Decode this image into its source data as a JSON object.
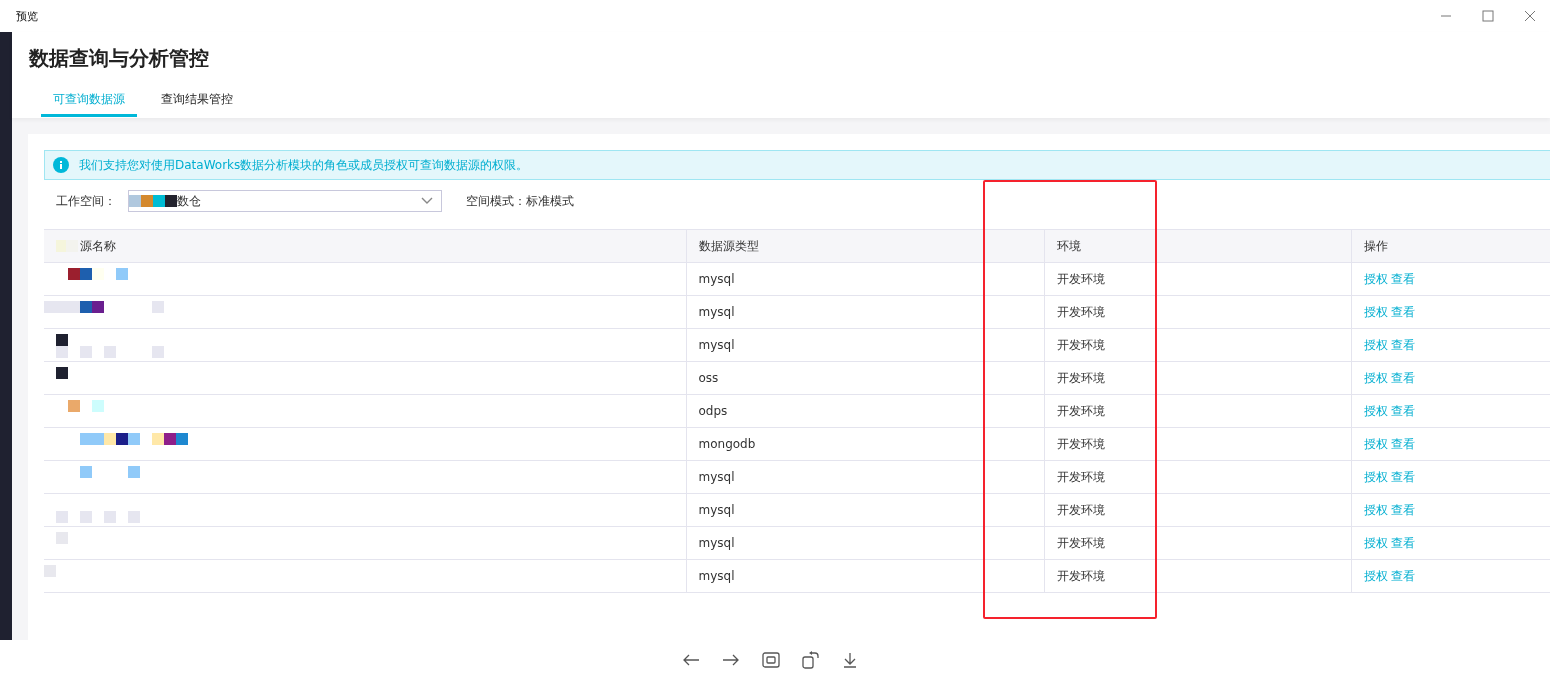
{
  "window": {
    "title": "预览"
  },
  "page": {
    "title": "数据查询与分析管控"
  },
  "tabs": [
    {
      "label": "可查询数据源",
      "selected": true
    },
    {
      "label": "查询结果管控",
      "selected": false
    }
  ],
  "notice": "我们支持您对使用DataWorks数据分析模块的角色或成员授权可查询数据源的权限。",
  "filters": {
    "workspace_label": "工作空间：",
    "workspace_value": "数仓",
    "mode": "空间模式：标准模式"
  },
  "table": {
    "columns": [
      "源名称",
      "数据源类型",
      "环境",
      "操作"
    ],
    "rows": [
      {
        "type": "mysql",
        "env": "开发环境",
        "actions": [
          "授权",
          "查看"
        ]
      },
      {
        "type": "mysql",
        "env": "开发环境",
        "actions": [
          "授权",
          "查看"
        ]
      },
      {
        "type": "mysql",
        "env": "开发环境",
        "actions": [
          "授权",
          "查看"
        ]
      },
      {
        "type": "oss",
        "env": "开发环境",
        "actions": [
          "授权",
          "查看"
        ]
      },
      {
        "type": "odps",
        "env": "开发环境",
        "actions": [
          "授权",
          "查看"
        ]
      },
      {
        "type": "mongodb",
        "env": "开发环境",
        "actions": [
          "授权",
          "查看"
        ]
      },
      {
        "type": "mysql",
        "env": "开发环境",
        "actions": [
          "授权",
          "查看"
        ]
      },
      {
        "type": "mysql",
        "env": "开发环境",
        "actions": [
          "授权",
          "查看"
        ]
      },
      {
        "type": "mysql",
        "env": "开发环境",
        "actions": [
          "授权",
          "查看"
        ]
      },
      {
        "type": "mysql",
        "env": "开发环境",
        "actions": [
          "授权",
          "查看"
        ]
      }
    ]
  }
}
